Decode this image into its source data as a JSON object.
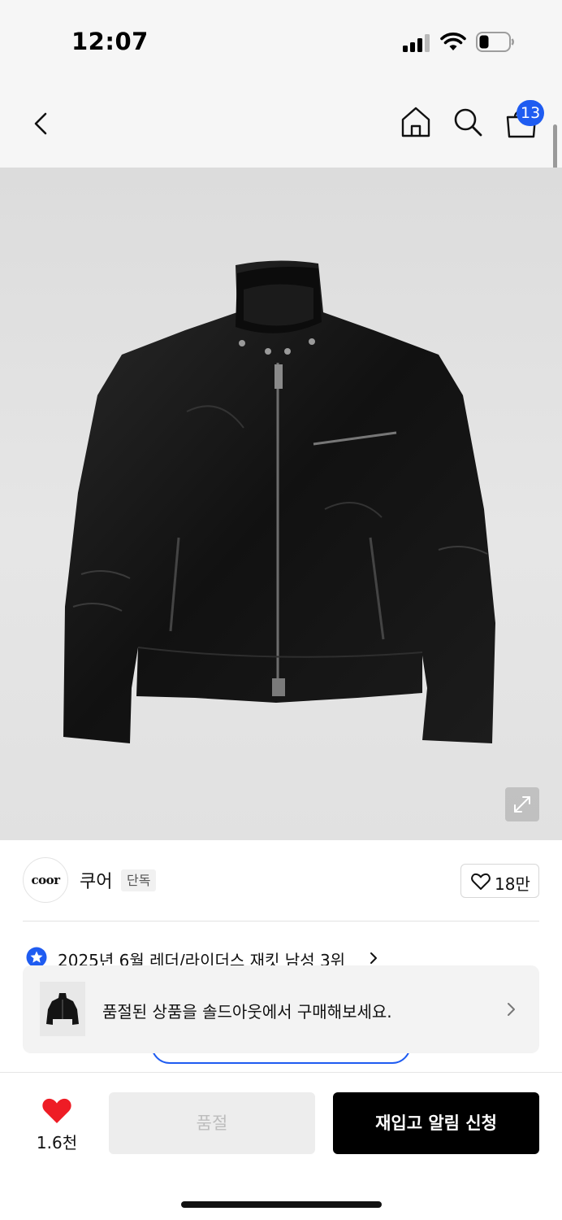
{
  "status_bar": {
    "time": "12:07"
  },
  "header": {
    "back_icon": "chevron-left-icon",
    "home_icon": "home-icon",
    "search_icon": "search-icon",
    "cart_icon": "shopping-bag-icon",
    "cart_count": "13",
    "badge_color": "#1f5cf1"
  },
  "product": {
    "image_icon": "leather-jacket-image",
    "expand_icon": "expand-icon"
  },
  "brand": {
    "logo_text": "coor",
    "name": "쿠어",
    "badge": "단독",
    "like_count": "18만"
  },
  "ranking": {
    "icon": "star-badge-icon",
    "text": "2025년 6월 레더/라이더스 재킷 남성 3위"
  },
  "soldout_banner": {
    "text": "품절된 상품을 솔드아웃에서 구매해보세요."
  },
  "bottom_bar": {
    "wish_count": "1.6천",
    "soldout_label": "품절",
    "restock_label": "재입고 알림 신청",
    "heart_color": "#ee1c25"
  }
}
